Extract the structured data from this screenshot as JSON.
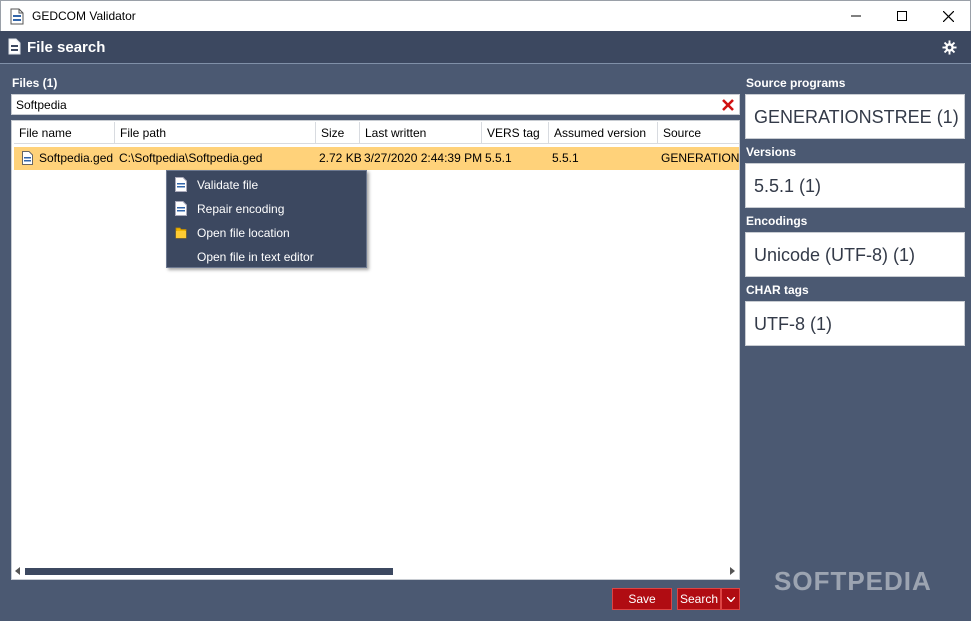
{
  "window": {
    "title": "GEDCOM Validator"
  },
  "header": {
    "title": "File search"
  },
  "files": {
    "label": "Files (1)",
    "search_value": "Softpedia",
    "columns": [
      "File name",
      "File path",
      "Size",
      "Last written",
      "VERS tag",
      "Assumed version",
      "Source"
    ],
    "rows": [
      [
        "Softpedia.ged",
        "C:\\Softpedia\\Softpedia.ged",
        "2.72 KB",
        "3/27/2020 2:44:39 PM",
        "5.5.1",
        "5.5.1",
        "GENERATIONS"
      ]
    ]
  },
  "context_menu": {
    "items": [
      "Validate file",
      "Repair encoding",
      "Open file location",
      "Open file in text editor"
    ]
  },
  "buttons": {
    "save": "Save",
    "search": "Search"
  },
  "side": {
    "sections": [
      {
        "label": "Source programs",
        "value": "GENERATIONSTREE (1)"
      },
      {
        "label": "Versions",
        "value": "5.5.1 (1)"
      },
      {
        "label": "Encodings",
        "value": "Unicode (UTF-8) (1)"
      },
      {
        "label": "CHAR tags",
        "value": "UTF-8 (1)"
      }
    ]
  },
  "watermark": "SOFTPEDIA",
  "colors": {
    "header": "#3c4860",
    "body": "#4b5972",
    "selected_row": "#ffd27a",
    "button": "#b00c12"
  }
}
